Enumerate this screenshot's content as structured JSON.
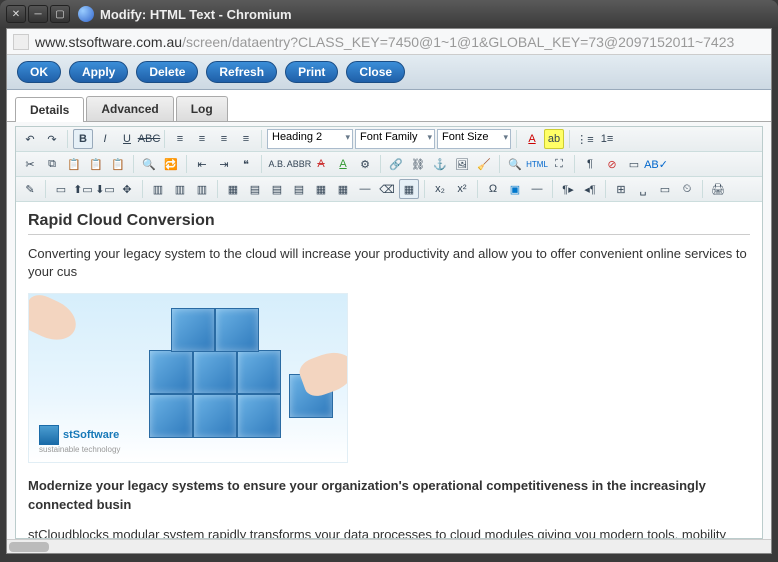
{
  "window": {
    "title": "Modify: HTML Text - Chromium"
  },
  "url": {
    "host": "www.stsoftware.com.au",
    "path": "/screen/dataentry?CLASS_KEY=7450@1~1@1&GLOBAL_KEY=73@2097152011~7423"
  },
  "actions": {
    "ok": "OK",
    "apply": "Apply",
    "delete": "Delete",
    "refresh": "Refresh",
    "print": "Print",
    "close": "Close"
  },
  "tabs": {
    "details": "Details",
    "advanced": "Advanced",
    "log": "Log"
  },
  "editor": {
    "format_block": "Heading 2",
    "font_family": "Font Family",
    "font_size": "Font Size",
    "html_btn": "HTML"
  },
  "doc": {
    "h2": "Rapid Cloud Conversion",
    "p1": "Converting your legacy system to the cloud will increase your productivity and allow you to offer convenient online services to your cus",
    "p2": "Modernize your legacy systems to ensure your organization's operational competitiveness in the increasingly connected busin",
    "p3": "stCloudblocks modular system rapidly transforms your data processes to cloud modules giving you modern tools, mobility and reducin",
    "logo_main": "stSoftware",
    "logo_sub": "sustainable technology"
  }
}
